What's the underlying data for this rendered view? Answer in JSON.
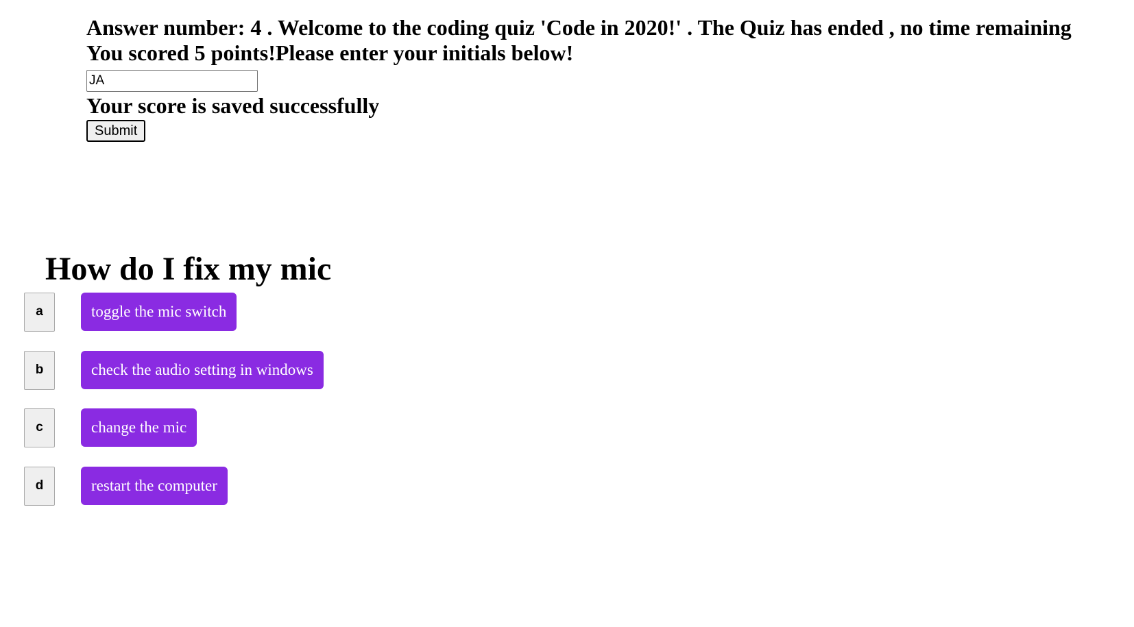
{
  "status": {
    "line1": "Answer number: 4 . Welcome to the coding quiz 'Code in 2020!' . The Quiz has ended , no time remaining",
    "line2": "You scored 5 points!Please enter your initials below!"
  },
  "initials_input": {
    "value": "JA"
  },
  "saved_message": "Your score is saved successfully",
  "submit_label": "Submit",
  "question": {
    "title": "How do I fix my mic",
    "answers": [
      {
        "letter": "a",
        "text": "toggle the mic switch"
      },
      {
        "letter": "b",
        "text": "check the audio setting in windows"
      },
      {
        "letter": "c",
        "text": "change the mic"
      },
      {
        "letter": "d",
        "text": "restart the computer"
      }
    ]
  },
  "colors": {
    "answer_button": "#8a2be2",
    "answer_text": "#ffffff",
    "letter_box": "#efefef"
  }
}
